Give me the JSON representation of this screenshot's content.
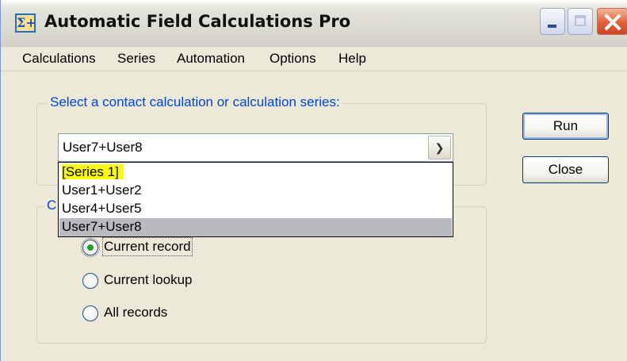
{
  "window": {
    "title": "Automatic Field Calculations Pro",
    "app_icon_glyph": "Σ+",
    "app_icon_name": "sigma-plus-icon"
  },
  "menubar": {
    "items": [
      "Calculations",
      "Series",
      "Automation",
      "Options",
      "Help"
    ]
  },
  "select_group": {
    "legend": "Select a contact calculation or calculation series:",
    "combo_value": "User7+User8",
    "options": [
      "[Series 1]",
      "User1+User2",
      "User4+User5",
      "User7+User8"
    ],
    "highlighted_option_index": 3
  },
  "calc_group": {
    "legend_partial": "C",
    "radios": [
      {
        "label": "Current record",
        "checked": true
      },
      {
        "label": "Current lookup",
        "checked": false
      },
      {
        "label": "All records",
        "checked": false
      }
    ]
  },
  "buttons": {
    "run": "Run",
    "close": "Close"
  },
  "colors": {
    "legend_text": "#0046d5",
    "window_bg": "#ece9d8",
    "highlight_yellow": "#ffff00",
    "selected_row": "#b9b9c0"
  }
}
